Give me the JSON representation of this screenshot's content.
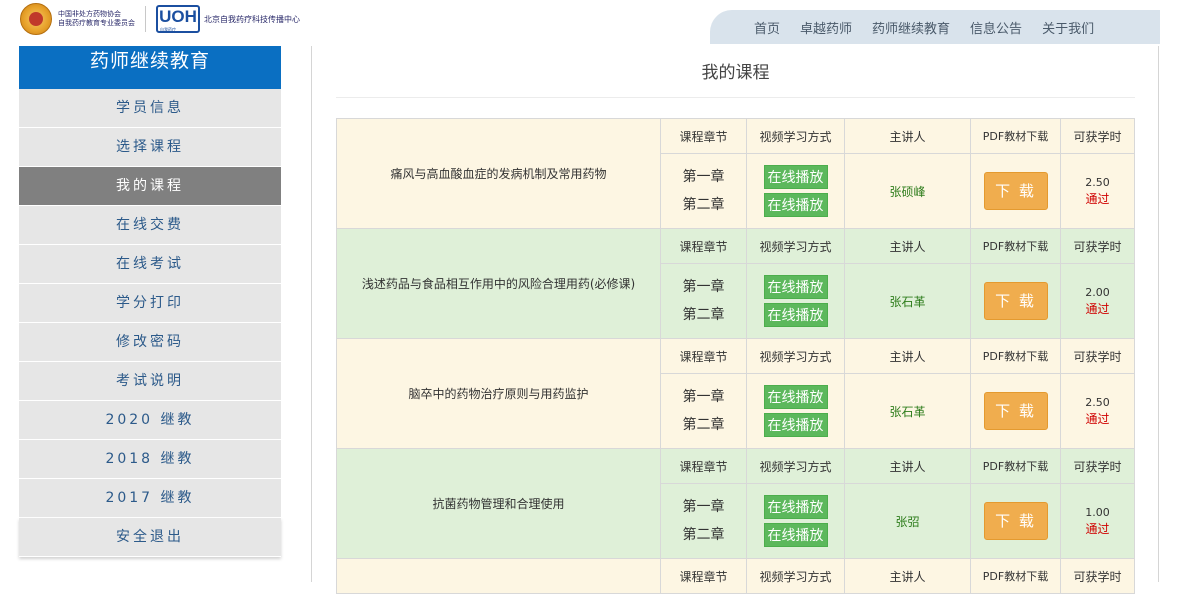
{
  "header": {
    "org_line1": "中国非处方药物协会",
    "org_line2": "自我药疗教育专业委员会",
    "logo_text": "UOH",
    "logo_sub": "自我药疗",
    "center_name": "北京自我药疗科技传播中心"
  },
  "nav": [
    "首页",
    "卓越药师",
    "药师继续教育",
    "信息公告",
    "关于我们"
  ],
  "sidebar": {
    "title": "药师继续教育",
    "items": [
      "学员信息",
      "选择课程",
      "我的课程",
      "在线交费",
      "在线考试",
      "学分打印",
      "修改密码",
      "考试说明",
      "2020 继教",
      "2018 继教",
      "2017 继教",
      "安全退出"
    ],
    "active_index": 2
  },
  "page_title": "我的课程",
  "table": {
    "headers": [
      "课程章节",
      "视频学习方式",
      "主讲人",
      "PDF教材下载",
      "可获学时"
    ],
    "play_label": "在线播放",
    "download_label": "下 载",
    "courses": [
      {
        "name": "痛风与高血酸血症的发病机制及常用药物",
        "chapters": [
          "第一章",
          "第二章"
        ],
        "lecturer": "张硕峰",
        "hours": "2.50",
        "status": "通过"
      },
      {
        "name": "浅述药品与食品相互作用中的风险合理用药(必修课)",
        "chapters": [
          "第一章",
          "第二章"
        ],
        "lecturer": "张石革",
        "hours": "2.00",
        "status": "通过"
      },
      {
        "name": "脑卒中的药物治疗原则与用药监护",
        "chapters": [
          "第一章",
          "第二章"
        ],
        "lecturer": "张石革",
        "hours": "2.50",
        "status": "通过"
      },
      {
        "name": "抗菌药物管理和合理使用",
        "chapters": [
          "第一章",
          "第二章"
        ],
        "lecturer": "张弨",
        "hours": "1.00",
        "status": "通过"
      }
    ]
  },
  "colors": {
    "accent": "#0a6fc2",
    "active_item": "#808080",
    "play_button": "#5cb85c",
    "download_button": "#f0ad4e",
    "row_yellow": "#fdf6e3",
    "row_green": "#dff0d8"
  }
}
